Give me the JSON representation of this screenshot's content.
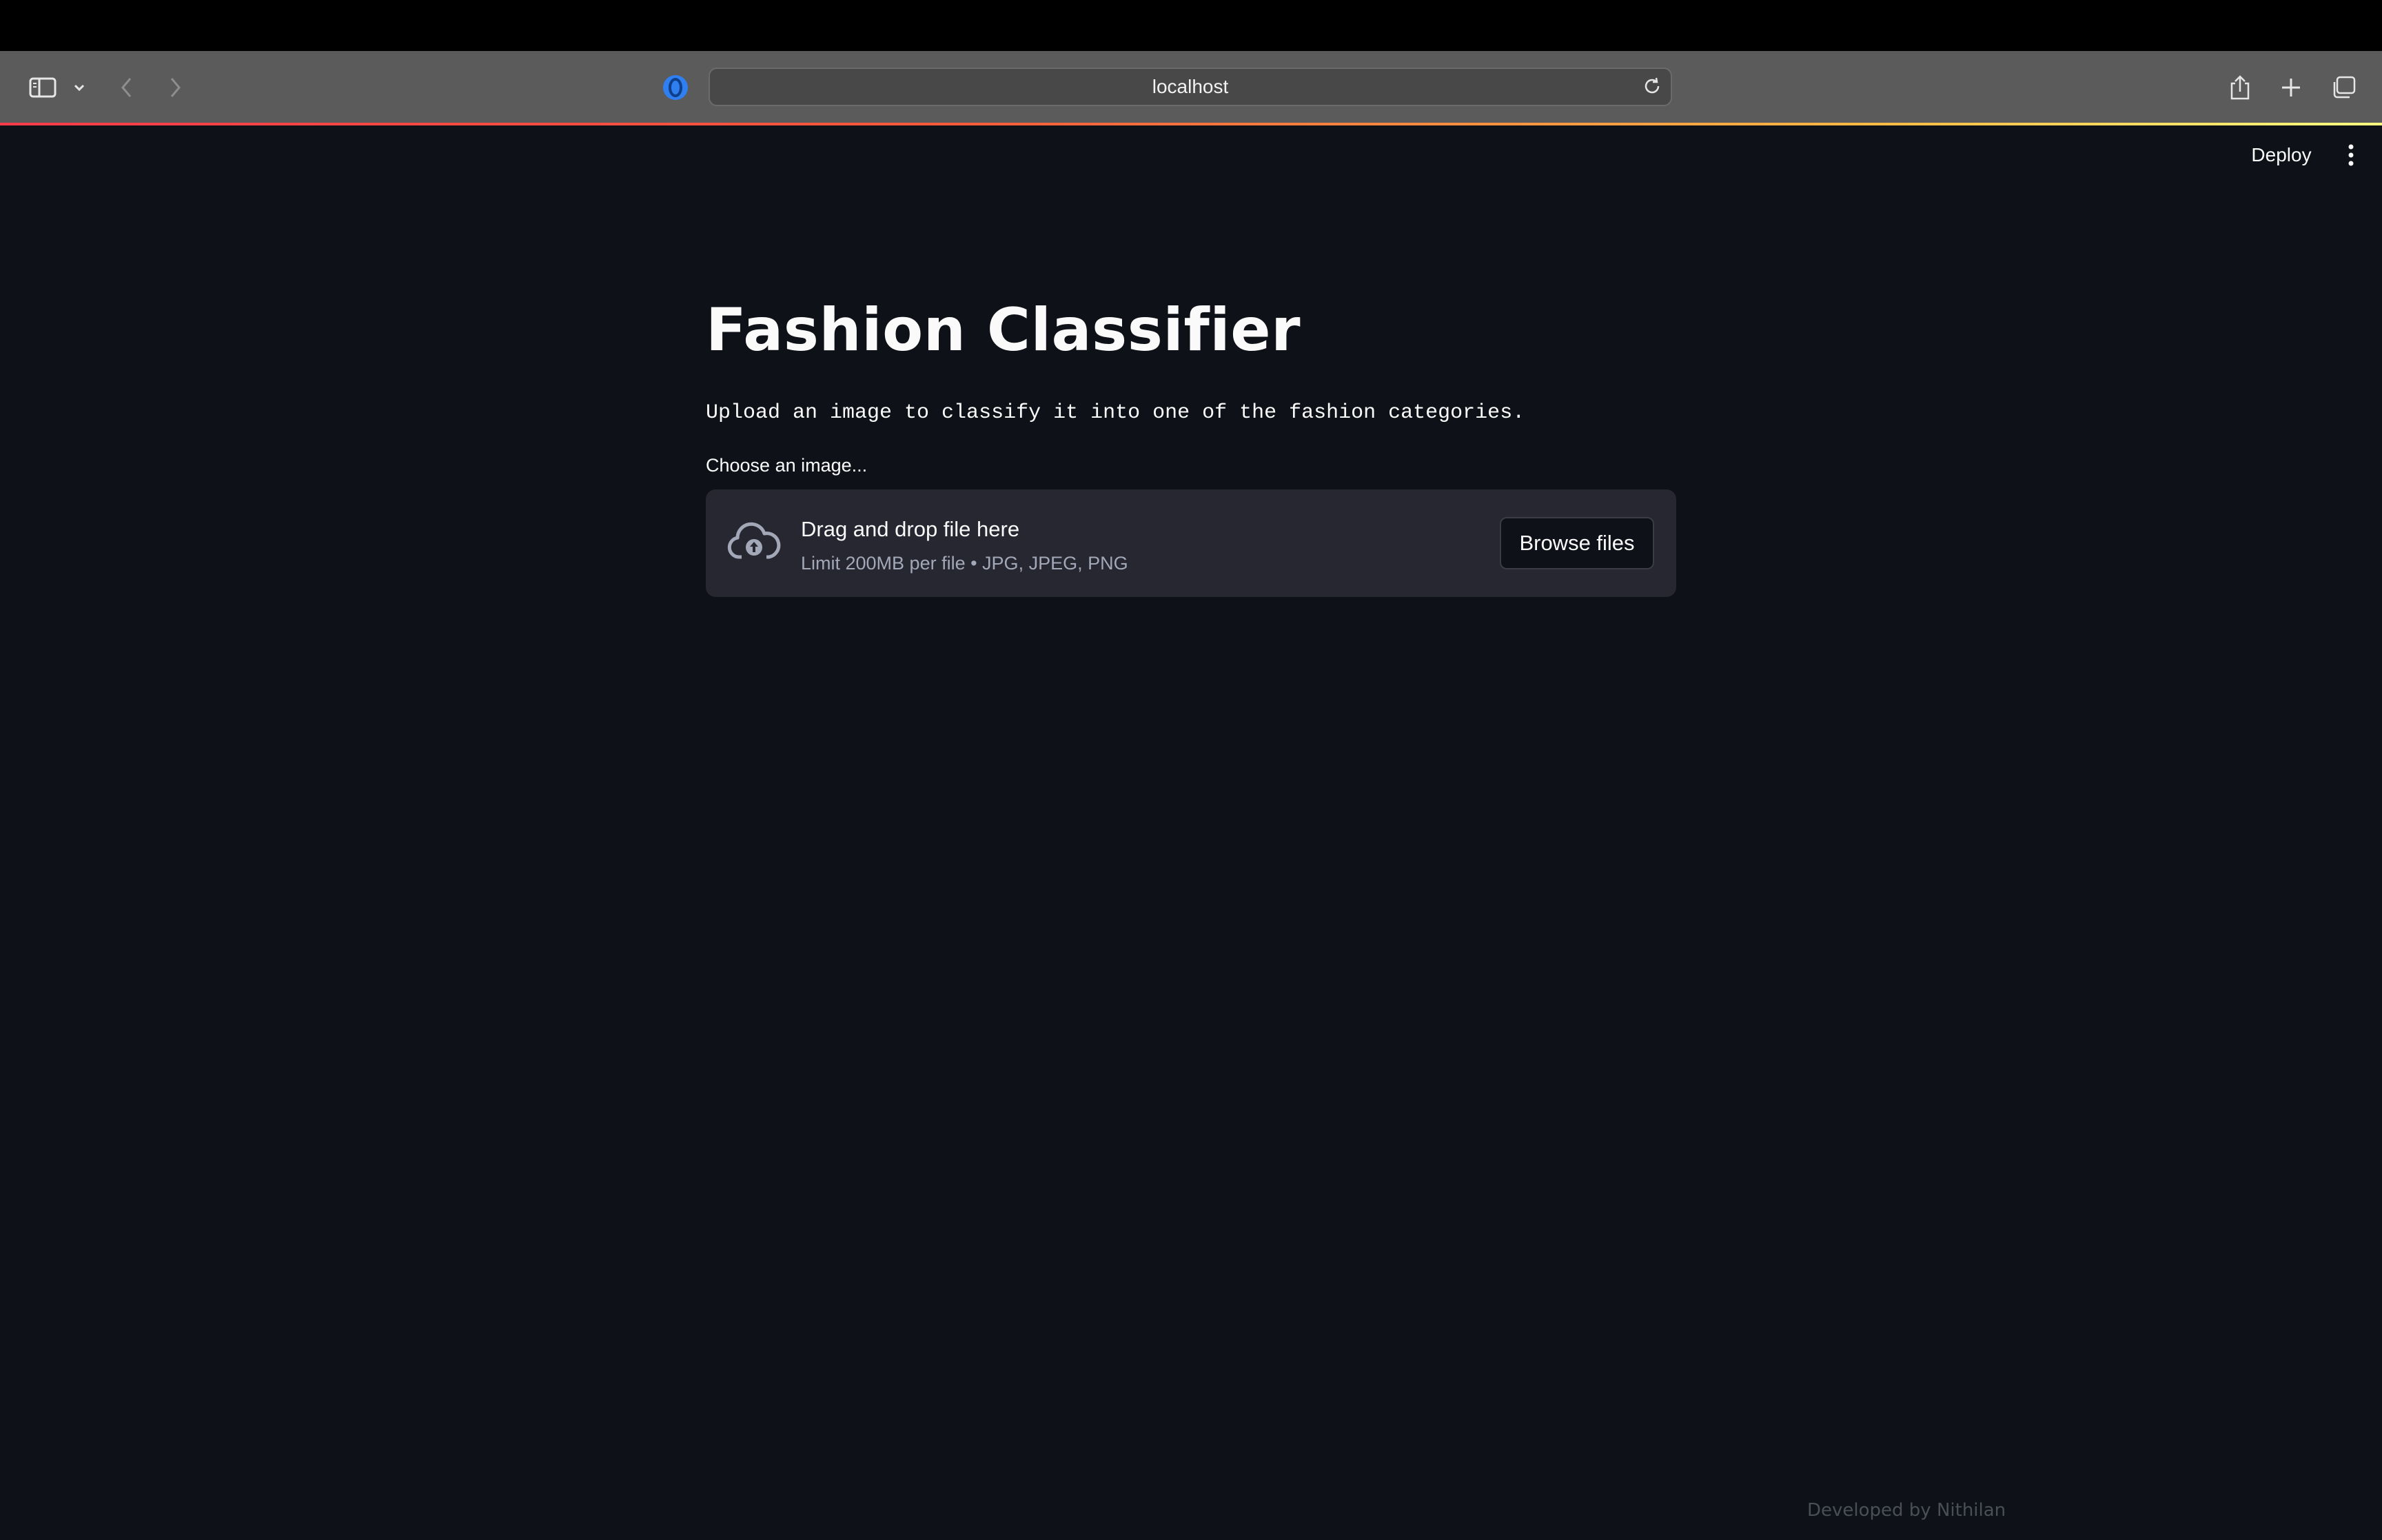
{
  "browser": {
    "address": "localhost"
  },
  "app": {
    "deploy_label": "Deploy",
    "title": "Fashion Classifier",
    "subtitle": "Upload an image to classify it into one of the fashion categories.",
    "uploader": {
      "label": "Choose an image...",
      "drop_text": "Drag and drop file here",
      "limit_text": "Limit 200MB per file • JPG, JPEG, PNG",
      "browse_label": "Browse files"
    },
    "footer": "Developed by Nithilan"
  },
  "icons": {
    "sidebar": "sidebar-icon",
    "chevron": "chevron-down-icon",
    "back": "back-arrow-icon",
    "forward": "forward-arrow-icon",
    "privacy": "privacy-shield-icon",
    "reload": "reload-icon",
    "share": "share-icon",
    "new_tab": "plus-icon",
    "tabs": "tabs-overview-icon",
    "menu": "kebab-menu-icon",
    "upload": "cloud-upload-icon"
  },
  "colors": {
    "background": "#0e1117",
    "dropzone": "#262730",
    "text": "#fafafa",
    "muted": "#a3a8b8"
  }
}
